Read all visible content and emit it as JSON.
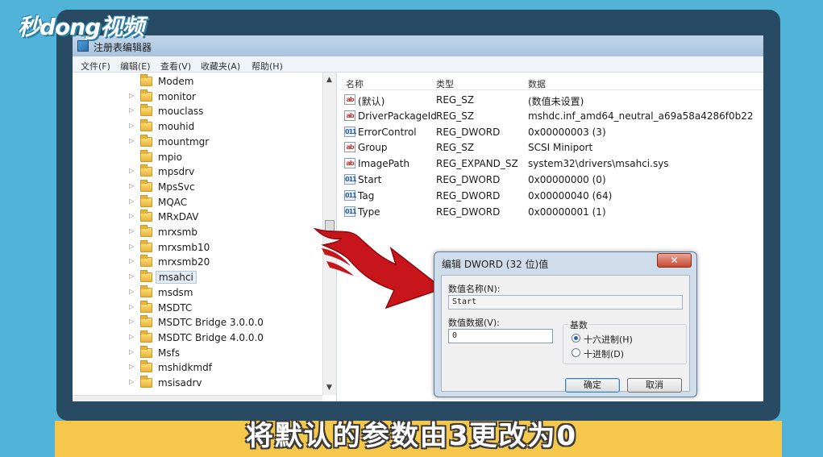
{
  "logo": {
    "text": "秒dong视频"
  },
  "window": {
    "title": "注册表编辑器"
  },
  "menu": [
    "文件(F)",
    "编辑(E)",
    "查看(V)",
    "收藏夹(A)",
    "帮助(H)"
  ],
  "tree": [
    {
      "label": "Modem",
      "expandable": false
    },
    {
      "label": "monitor",
      "expandable": true
    },
    {
      "label": "mouclass",
      "expandable": true
    },
    {
      "label": "mouhid",
      "expandable": true
    },
    {
      "label": "mountmgr",
      "expandable": true
    },
    {
      "label": "mpio",
      "expandable": false
    },
    {
      "label": "mpsdrv",
      "expandable": true
    },
    {
      "label": "MpsSvc",
      "expandable": true
    },
    {
      "label": "MQAC",
      "expandable": true
    },
    {
      "label": "MRxDAV",
      "expandable": true
    },
    {
      "label": "mrxsmb",
      "expandable": true
    },
    {
      "label": "mrxsmb10",
      "expandable": true
    },
    {
      "label": "mrxsmb20",
      "expandable": true
    },
    {
      "label": "msahci",
      "expandable": true,
      "selected": true
    },
    {
      "label": "msdsm",
      "expandable": true
    },
    {
      "label": "MSDTC",
      "expandable": true
    },
    {
      "label": "MSDTC Bridge 3.0.0.0",
      "expandable": true
    },
    {
      "label": "MSDTC Bridge 4.0.0.0",
      "expandable": true
    },
    {
      "label": "Msfs",
      "expandable": true
    },
    {
      "label": "mshidkmdf",
      "expandable": true
    },
    {
      "label": "msisadrv",
      "expandable": true
    }
  ],
  "columns": {
    "name": "名称",
    "type": "类型",
    "data": "数据"
  },
  "values": [
    {
      "name": "(默认)",
      "type": "REG_SZ",
      "data": "(数值未设置)",
      "icon": "string-value-icon"
    },
    {
      "name": "DriverPackageId",
      "type": "REG_SZ",
      "data": "mshdc.inf_amd64_neutral_a69a58a4286f0b22",
      "icon": "string-value-icon"
    },
    {
      "name": "ErrorControl",
      "type": "REG_DWORD",
      "data": "0x00000003 (3)",
      "icon": "dword-value-icon"
    },
    {
      "name": "Group",
      "type": "REG_SZ",
      "data": "SCSI Miniport",
      "icon": "string-value-icon"
    },
    {
      "name": "ImagePath",
      "type": "REG_EXPAND_SZ",
      "data": "system32\\drivers\\msahci.sys",
      "icon": "string-value-icon"
    },
    {
      "name": "Start",
      "type": "REG_DWORD",
      "data": "0x00000000 (0)",
      "icon": "dword-value-icon"
    },
    {
      "name": "Tag",
      "type": "REG_DWORD",
      "data": "0x00000040 (64)",
      "icon": "dword-value-icon"
    },
    {
      "name": "Type",
      "type": "REG_DWORD",
      "data": "0x00000001 (1)",
      "icon": "dword-value-icon"
    }
  ],
  "dialog": {
    "title": "编辑 DWORD (32 位)值",
    "close": "✕",
    "name_label": "数值名称(N):",
    "name_value": "Start",
    "data_label": "数值数据(V):",
    "data_value": "0",
    "base_label": "基数",
    "hex_label": "十六进制(H)",
    "dec_label": "十进制(D)",
    "selected_base": "hex",
    "ok": "确定",
    "cancel": "取消"
  },
  "subtitle": "将默认的参数由3更改为0",
  "colors": {
    "arrow": "#c8141b",
    "background": "#52b3d9",
    "band": "#f5c74a",
    "frame": "#294a63"
  }
}
